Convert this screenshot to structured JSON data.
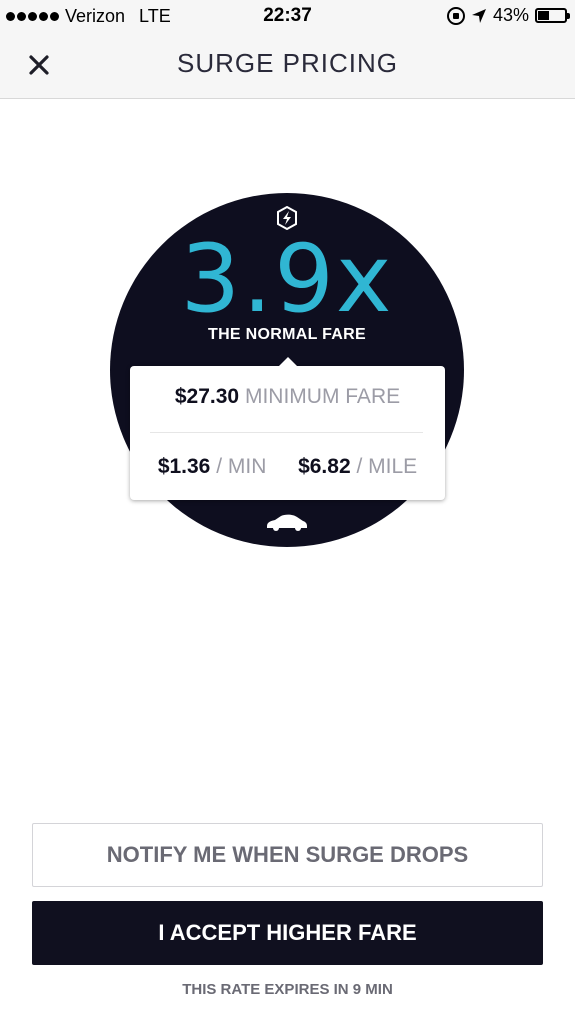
{
  "status_bar": {
    "carrier": "Verizon",
    "network": "LTE",
    "time": "22:37",
    "battery_percent": "43%",
    "battery_level": 0.43
  },
  "nav": {
    "title": "SURGE PRICING",
    "close_icon": "close-icon"
  },
  "surge": {
    "multiplier": "3.9x",
    "caption": "THE NORMAL FARE",
    "accent_color": "#30b6d3",
    "circle_color": "#0e0e1f"
  },
  "fares": {
    "minimum_fare_value": "$27.30",
    "minimum_fare_label": "MINIMUM FARE",
    "per_min_value": "$1.36",
    "per_min_label": "/ MIN",
    "per_mile_value": "$6.82",
    "per_mile_label": "/ MILE"
  },
  "actions": {
    "notify_label": "NOTIFY ME WHEN SURGE DROPS",
    "accept_label": "I ACCEPT HIGHER FARE"
  },
  "footer": {
    "expires_text": "THIS RATE EXPIRES IN 9 MIN"
  }
}
